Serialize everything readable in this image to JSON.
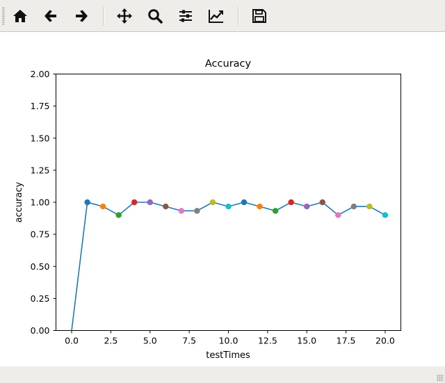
{
  "toolbar": {
    "buttons": [
      {
        "name": "home-button",
        "icon": "home-icon",
        "tooltip": "Reset original view"
      },
      {
        "name": "back-button",
        "icon": "arrow-left-icon",
        "tooltip": "Back to previous view"
      },
      {
        "name": "forward-button",
        "icon": "arrow-right-icon",
        "tooltip": "Forward to next view"
      },
      {
        "name": "pan-button",
        "icon": "move-arrows-icon",
        "tooltip": "Pan axes"
      },
      {
        "name": "zoom-button",
        "icon": "magnifier-icon",
        "tooltip": "Zoom to rectangle"
      },
      {
        "name": "subplots-button",
        "icon": "sliders-icon",
        "tooltip": "Configure subplots"
      },
      {
        "name": "edit-axis-button",
        "icon": "line-chart-icon",
        "tooltip": "Edit axis, curve and image parameters"
      },
      {
        "name": "save-button",
        "icon": "floppy-disk-icon",
        "tooltip": "Save the figure"
      }
    ]
  },
  "chart_data": {
    "type": "line",
    "title": "Accuracy",
    "xlabel": "testTimes",
    "ylabel": "accuracy",
    "xlim": [
      -1,
      21
    ],
    "ylim": [
      0,
      2
    ],
    "xticks": [
      "0.0",
      "2.5",
      "5.0",
      "7.5",
      "10.0",
      "12.5",
      "15.0",
      "17.5",
      "20.0"
    ],
    "xtick_values": [
      0,
      2.5,
      5,
      7.5,
      10,
      12.5,
      15,
      17.5,
      20
    ],
    "yticks": [
      "0.00",
      "0.25",
      "0.50",
      "0.75",
      "1.00",
      "1.25",
      "1.50",
      "1.75",
      "2.00"
    ],
    "ytick_values": [
      0,
      0.25,
      0.5,
      0.75,
      1.0,
      1.25,
      1.5,
      1.75,
      2.0
    ],
    "grid": false,
    "line_color": "#1f77b4",
    "x": [
      0,
      1,
      2,
      3,
      4,
      5,
      6,
      7,
      8,
      9,
      10,
      11,
      12,
      13,
      14,
      15,
      16,
      17,
      18,
      19,
      20
    ],
    "y": [
      0,
      1.0,
      0.967,
      0.9,
      1.0,
      1.0,
      0.967,
      0.933,
      0.933,
      1.0,
      0.967,
      1.0,
      0.967,
      0.933,
      1.0,
      0.967,
      1.0,
      0.9,
      0.967,
      0.967,
      0.9
    ],
    "marker_colors": [
      "#1f77b4",
      "#ff7f0e",
      "#2ca02c",
      "#d62728",
      "#9467bd",
      "#8c564b",
      "#e377c2",
      "#7f7f7f",
      "#bcbd22",
      "#17becf"
    ]
  }
}
